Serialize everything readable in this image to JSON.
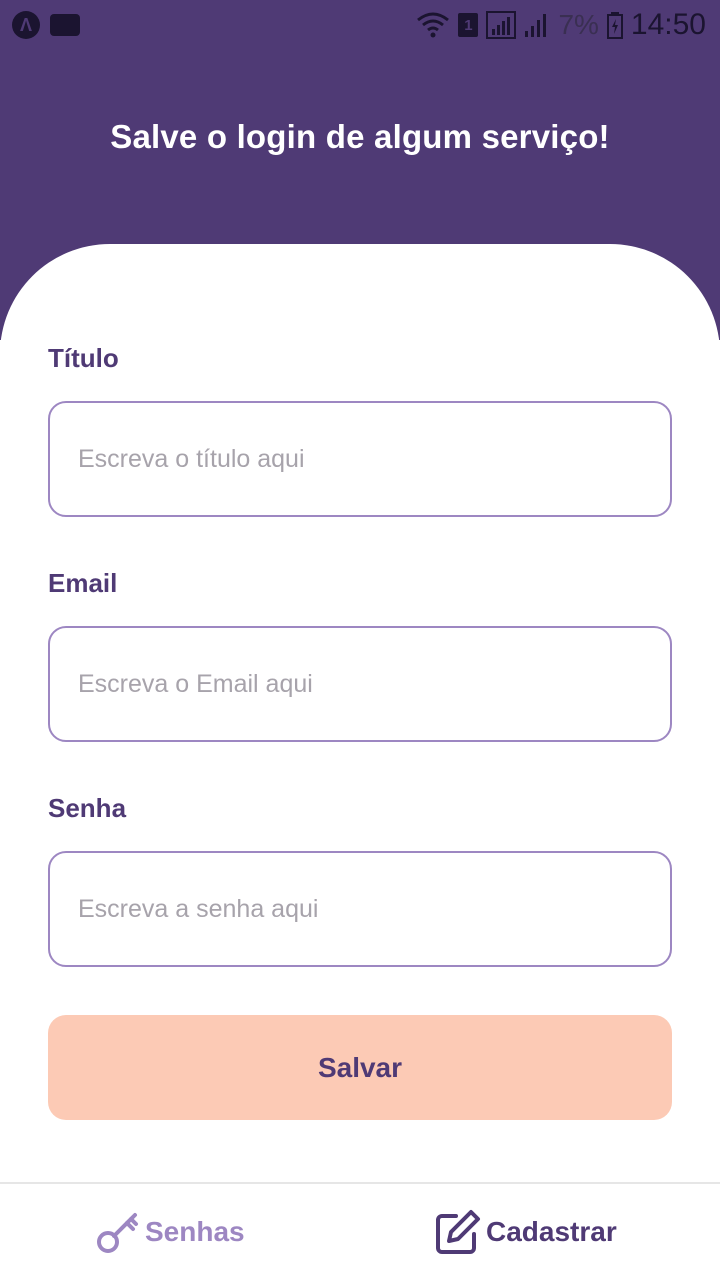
{
  "status_bar": {
    "sim_slot": "1",
    "battery_percent": "7%",
    "time": "14:50"
  },
  "header": {
    "title": "Salve o login de algum serviço!"
  },
  "form": {
    "title_label": "Título",
    "title_placeholder": "Escreva o título aqui",
    "email_label": "Email",
    "email_placeholder": "Escreva o Email aqui",
    "password_label": "Senha",
    "password_placeholder": "Escreva a senha aqui",
    "save_label": "Salvar"
  },
  "tabs": [
    {
      "label": "Senhas",
      "icon": "key-icon",
      "active": false
    },
    {
      "label": "Cadastrar",
      "icon": "edit-icon",
      "active": true
    }
  ],
  "colors": {
    "primary": "#4f3a75",
    "accent_light": "#9d87c2",
    "button": "#fccab5"
  }
}
